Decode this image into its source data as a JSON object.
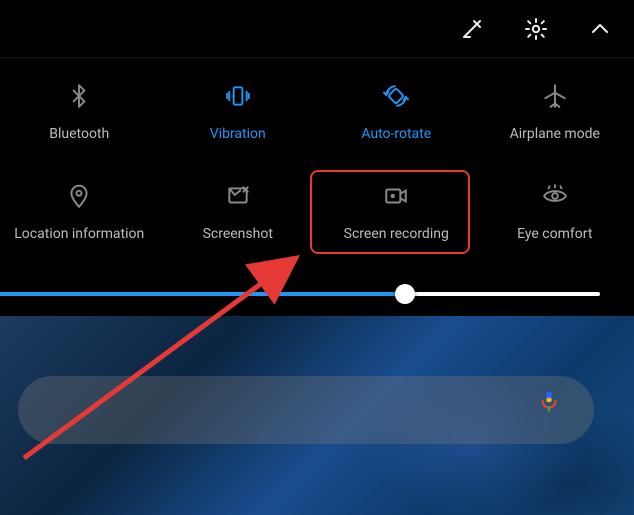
{
  "colors": {
    "accent": "#2196f3",
    "inactive": "#8a8a8a",
    "highlight": "#e53935"
  },
  "header": {
    "edit_icon": "edit",
    "settings_icon": "gear",
    "expand_icon": "chevron-up"
  },
  "tiles": {
    "row1": [
      {
        "label": "Bluetooth",
        "active": false
      },
      {
        "label": "Vibration",
        "active": true
      },
      {
        "label": "Auto-rotate",
        "active": true
      },
      {
        "label": "Airplane mode",
        "active": false
      }
    ],
    "row2": [
      {
        "label": "Location information",
        "active": false
      },
      {
        "label": "Screenshot",
        "active": false
      },
      {
        "label": "Screen recording",
        "active": false
      },
      {
        "label": "Eye comfort",
        "active": false
      }
    ]
  },
  "brightness": {
    "value_percent": 66
  },
  "search": {
    "placeholder": ""
  },
  "annotation": {
    "highlighted_tile": "Screen recording"
  }
}
